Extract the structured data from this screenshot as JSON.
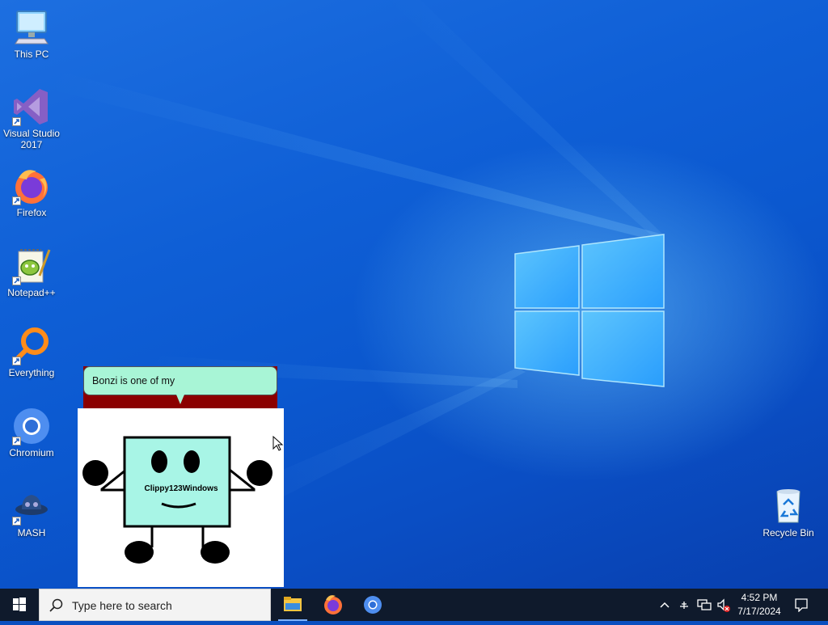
{
  "desktop": {
    "icons": [
      {
        "label": "This PC",
        "icon": "this-pc-icon"
      },
      {
        "label": "Visual Studio 2017",
        "icon": "visual-studio-icon"
      },
      {
        "label": "Firefox",
        "icon": "firefox-icon"
      },
      {
        "label": "Notepad++",
        "icon": "notepad-plus-plus-icon"
      },
      {
        "label": "Everything",
        "icon": "everything-search-icon"
      },
      {
        "label": "Chromium",
        "icon": "chromium-icon"
      },
      {
        "label": "MASH",
        "icon": "mash-icon"
      },
      {
        "label": "Recycle Bin",
        "icon": "recycle-bin-icon"
      }
    ]
  },
  "agent": {
    "speech": "Bonzi is one of my",
    "character_label": "Clippy123Windows",
    "colors": {
      "bubble": "#a8f5d6",
      "bubble_border": "#8b0000",
      "body": "#a8f5e6"
    }
  },
  "taskbar": {
    "search_placeholder": "Type here to search",
    "apps": [
      {
        "name": "File Explorer",
        "icon": "file-explorer-icon",
        "active": true
      },
      {
        "name": "Firefox",
        "icon": "firefox-icon",
        "active": false
      },
      {
        "name": "Chromium",
        "icon": "chromium-icon",
        "active": false
      }
    ],
    "tray": {
      "time": "4:52 PM",
      "date": "7/17/2024",
      "icons": [
        "chevron-up-icon",
        "network-drive-icon",
        "network-icon",
        "volume-muted-icon",
        "notification-icon"
      ]
    }
  }
}
